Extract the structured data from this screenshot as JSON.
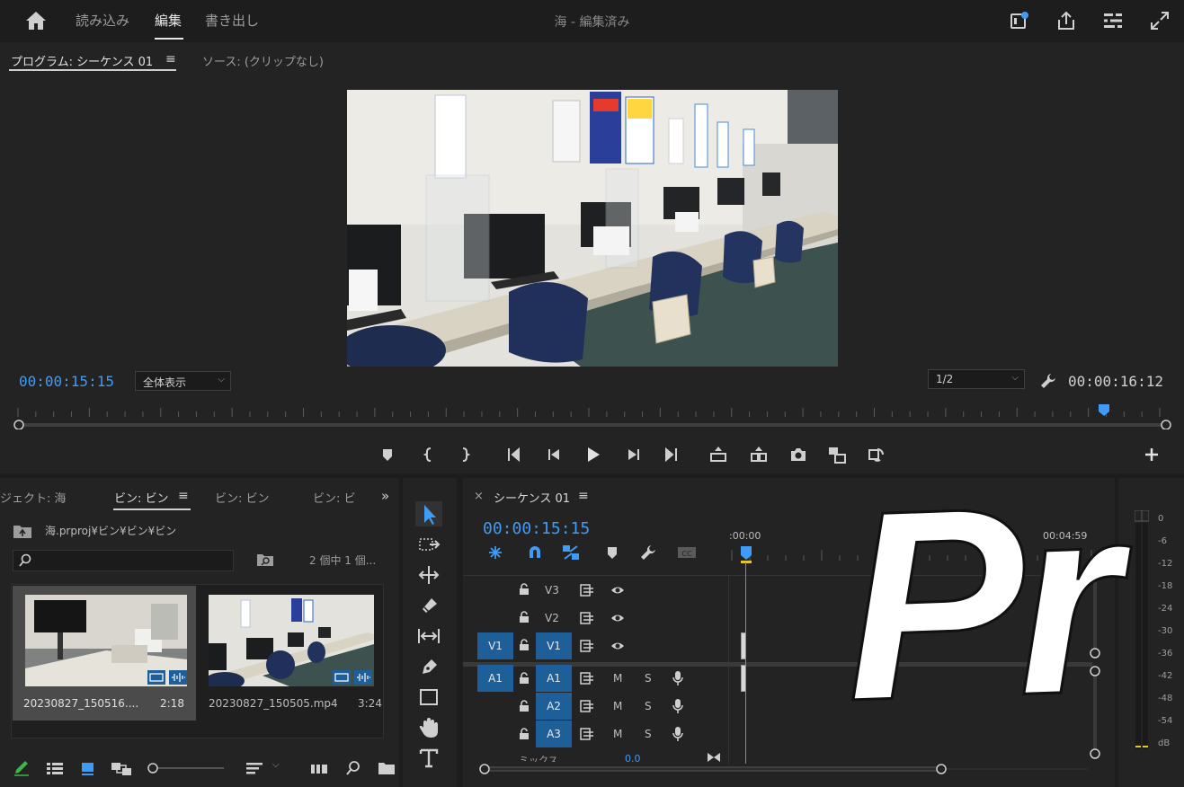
{
  "header": {
    "home_icon": "home-icon",
    "tabs": [
      {
        "label": "読み込み",
        "active": false
      },
      {
        "label": "編集",
        "active": true
      },
      {
        "label": "書き出し",
        "active": false
      }
    ],
    "title": "海 - 編集済み",
    "right_icons": [
      "notification-icon",
      "share-icon",
      "workspace-menu-icon",
      "fullscreen-icon"
    ]
  },
  "program_monitor": {
    "tabs": [
      {
        "label": "プログラム: シーケンス 01",
        "active": true
      },
      {
        "label": "ソース: (クリップなし)",
        "active": false
      }
    ],
    "menu_icon": "≡",
    "current_timecode": "00:00:15:15",
    "zoom": "全体表示",
    "resolution": "1/2",
    "duration_timecode": "00:00:16:12",
    "playhead_fraction": 0.951
  },
  "project_panel": {
    "tabs": [
      {
        "label": "ジェクト: 海",
        "active": false
      },
      {
        "label": "ビン: ビン",
        "active": true
      },
      {
        "label": "ビン: ビン",
        "active": false
      },
      {
        "label": "ビン: ビ",
        "active": false
      }
    ],
    "path": "海.prproj¥ビン¥ビン¥ビン",
    "search_value": "",
    "item_count": "2 個中 1 個...",
    "clips": [
      {
        "name": "20230827_150516....",
        "duration": "2:18",
        "selected": true
      },
      {
        "name": "20230827_150505.mp4",
        "duration": "3:24",
        "selected": false
      }
    ]
  },
  "timeline": {
    "title": "シーケンス 01",
    "timecode": "00:00:15:15",
    "ruler_start": ":00:00",
    "ruler_end": "00:04:59",
    "video_tracks": [
      {
        "target": "",
        "label": "V3",
        "highlight": false
      },
      {
        "target": "",
        "label": "V2",
        "highlight": false
      },
      {
        "target": "V1",
        "label": "V1",
        "highlight": true
      }
    ],
    "audio_tracks": [
      {
        "target": "A1",
        "label": "A1",
        "highlight": true
      },
      {
        "target": "",
        "label": "A2",
        "highlight": true
      },
      {
        "target": "",
        "label": "A3",
        "highlight": true
      }
    ],
    "mute_label": "M",
    "solo_label": "S",
    "mix_label": "ミックス",
    "mix_value": "0.0"
  },
  "audio_meter": {
    "scale": [
      "0",
      "-6",
      "-12",
      "-18",
      "-24",
      "-30",
      "-36",
      "-42",
      "-48",
      "-54",
      "dB"
    ]
  },
  "overlay_logo": "Pr",
  "colors": {
    "accent_blue": "#3f9bf5",
    "track_blue": "#1f5f99",
    "panel_bg": "#232323"
  }
}
